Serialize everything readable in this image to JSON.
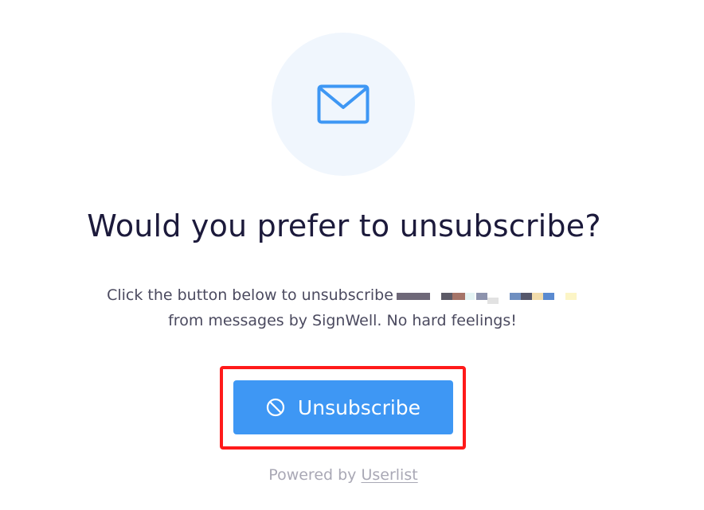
{
  "hero": {
    "icon": "envelope-icon",
    "circle_color": "#f0f6fd",
    "icon_color": "#3e97f4"
  },
  "headline": "Would you prefer to unsubscribe?",
  "message": {
    "line1": "Click the button below to unsubscribe",
    "line2": "from messages by SignWell. No hard feelings!"
  },
  "unsubscribe_button": {
    "label": "Unsubscribe",
    "icon": "no-entry-icon",
    "color": "#3e97f4",
    "highlight_color": "#ff1a1a"
  },
  "footer": {
    "prefix": "Powered by",
    "link": "Userlist"
  }
}
